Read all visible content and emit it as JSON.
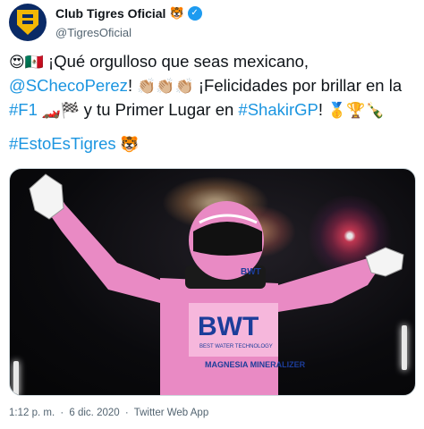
{
  "tweet": {
    "display_name": "Club Tigres Oficial",
    "handle": "@TigresOficial",
    "verified_mark": "✓",
    "name_emoji": "🐯",
    "lines": [
      {
        "prefix_emoji": "😍🇲🇽",
        "text": " ¡Qué orgulloso que seas mexicano,"
      },
      {
        "mention": "@SChecoPerez",
        "text_a": "! ",
        "emoji": "👏🏼👏🏼👏🏼",
        "text_b": " ¡Felicidades por brillar en la"
      },
      {
        "hashtag_a": "#F1",
        "emoji_a": " 🏎️🏁 ",
        "text": "y tu Primer Lugar en ",
        "hashtag_b": "#ShakirGP",
        "text_b": "! ",
        "emoji_b": "🥇🏆🍾"
      }
    ],
    "hashtag_line": {
      "hashtag": "#EstoEsTigres",
      "emoji": " 🐯"
    },
    "photo": {
      "suit_text_bwt": "BWT",
      "suit_text_small": "BEST WATER TECHNOLOGY",
      "suit_text_sponsor": "MAGNESIA MINERALIZER"
    },
    "time": "1:12 p. m.",
    "separator": "·",
    "date": "6 dic. 2020",
    "source": "Twitter Web App"
  },
  "colors": {
    "link": "#1b95e0",
    "verified": "#1d9bf0",
    "suit_pink": "#e98ac4",
    "suit_blue": "#1c3d9a"
  }
}
